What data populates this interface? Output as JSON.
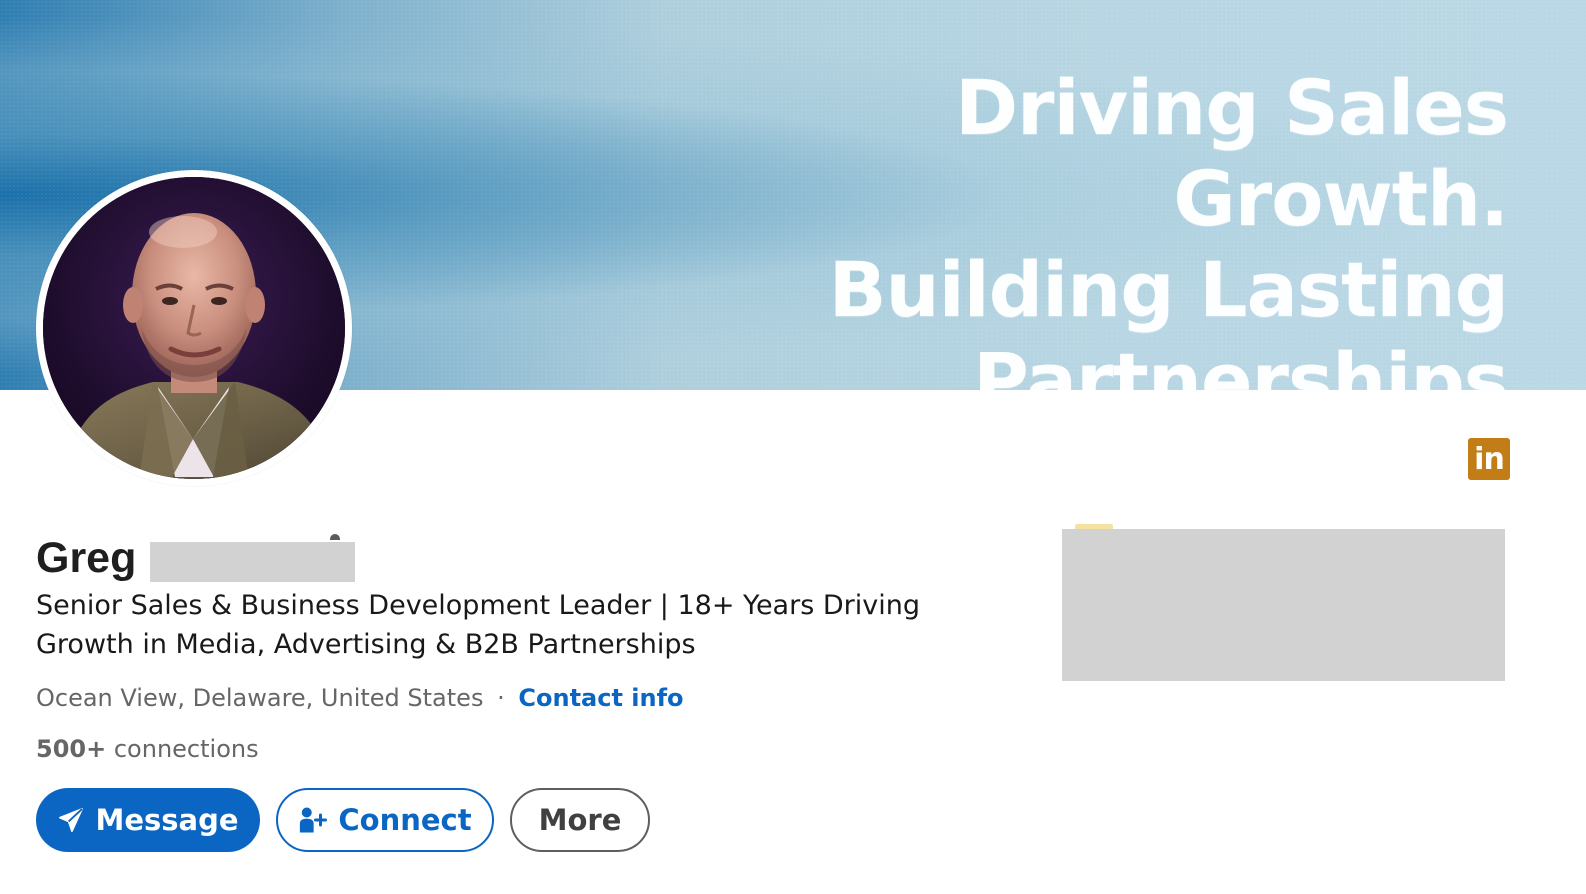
{
  "banner": {
    "line1": "Driving Sales Growth.",
    "line2": "Building Lasting",
    "line3": "Partnerships"
  },
  "profile": {
    "first_name": "Greg",
    "headline_line1": "Senior Sales & Business Development Leader | 18+ Years Driving",
    "headline_line2": "Growth in Media, Advertising & B2B Partnerships",
    "location": "Ocean View, Delaware, United States",
    "separator": "·",
    "contact_info_label": "Contact info",
    "connections_count": "500+",
    "connections_label": "connections"
  },
  "badge": {
    "label": "in",
    "color": "#c37d16"
  },
  "actions": {
    "message_label": "Message",
    "connect_label": "Connect",
    "more_label": "More"
  },
  "colors": {
    "primary": "#0a66c2",
    "redaction": "#d2d2d3"
  },
  "icons": {
    "message": "paper-plane-icon",
    "connect": "person-add-icon",
    "brand": "linkedin-icon"
  }
}
